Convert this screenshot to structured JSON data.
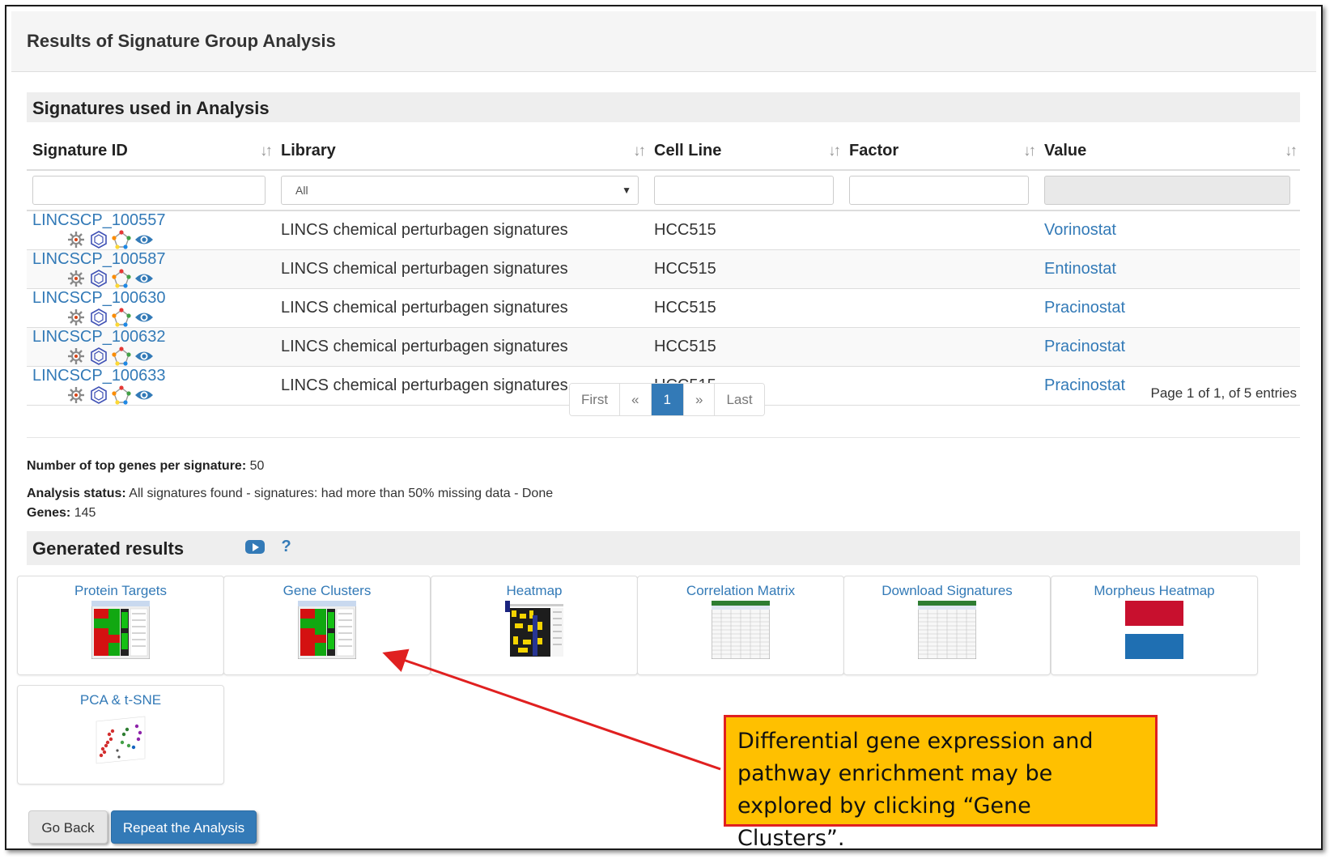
{
  "panel": {
    "title": "Results of Signature Group Analysis"
  },
  "signatures_section": {
    "title": "Signatures used in Analysis"
  },
  "table": {
    "columns": [
      "Signature ID",
      "Library",
      "Cell Line",
      "Factor",
      "Value"
    ],
    "sort_glyph": "↓↑",
    "library_filter_value": "All",
    "rows": [
      {
        "id": "LINCSCP_100557",
        "library": "LINCS chemical perturbagen signatures",
        "cell_line": "HCC515",
        "factor": "",
        "value": "Vorinostat"
      },
      {
        "id": "LINCSCP_100587",
        "library": "LINCS chemical perturbagen signatures",
        "cell_line": "HCC515",
        "factor": "",
        "value": "Entinostat"
      },
      {
        "id": "LINCSCP_100630",
        "library": "LINCS chemical perturbagen signatures",
        "cell_line": "HCC515",
        "factor": "",
        "value": "Pracinostat"
      },
      {
        "id": "LINCSCP_100632",
        "library": "LINCS chemical perturbagen signatures",
        "cell_line": "HCC515",
        "factor": "",
        "value": "Pracinostat"
      },
      {
        "id": "LINCSCP_100633",
        "library": "LINCS chemical perturbagen signatures",
        "cell_line": "HCC515",
        "factor": "",
        "value": "Pracinostat"
      }
    ],
    "row_icons": [
      "gear-icon",
      "hexagon-icon",
      "pentagon-network-icon",
      "eye-icon"
    ]
  },
  "pagination": {
    "first": "First",
    "prev": "«",
    "current": "1",
    "next": "»",
    "last": "Last",
    "info": "Page 1 of 1, of 5 entries"
  },
  "analysis": {
    "top_genes_label": "Number of top genes per signature:",
    "top_genes_value": "50",
    "status_label": "Analysis status:",
    "status_value": "All signatures found - signatures: had more than 50% missing data - Done",
    "genes_label": "Genes:",
    "genes_value": "145"
  },
  "generated": {
    "title": "Generated results",
    "help_symbol": "?",
    "cards": [
      {
        "label": "Protein Targets",
        "thumb": "heatmap-thumbnail"
      },
      {
        "label": "Gene Clusters",
        "thumb": "heatmap-thumbnail"
      },
      {
        "label": "Heatmap",
        "thumb": "yellow-heatmap-thumbnail"
      },
      {
        "label": "Correlation Matrix",
        "thumb": "spreadsheet-thumbnail"
      },
      {
        "label": "Download Signatures",
        "thumb": "spreadsheet-thumbnail"
      },
      {
        "label": "Morpheus Heatmap",
        "thumb": "morpheus-logo"
      },
      {
        "label": "PCA & t-SNE",
        "thumb": "scatter-plot-thumbnail"
      }
    ]
  },
  "buttons": {
    "back": "Go Back",
    "repeat": "Repeat the Analysis"
  },
  "callout": {
    "text": "Differential gene expression and pathway enrichment may be explored by clicking “Gene Clusters”."
  },
  "colors": {
    "link": "#337ab7",
    "callout_bg": "#ffc000",
    "callout_border": "#e02020",
    "arrow": "#e02020",
    "morpheus_red": "#c8102e",
    "morpheus_blue": "#1f6fb2"
  }
}
